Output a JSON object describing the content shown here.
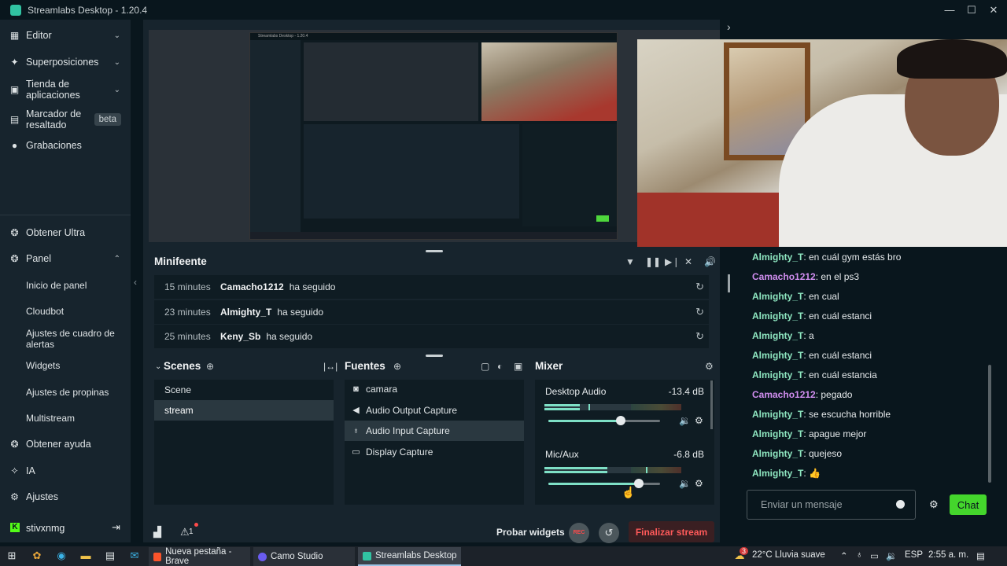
{
  "window": {
    "title": "Streamlabs Desktop - 1.20.4",
    "controls": [
      "—",
      "☐",
      "✕"
    ]
  },
  "sidebar": {
    "items": [
      {
        "label": "Editor",
        "icon": "editor-icon",
        "chevron": "⌄"
      },
      {
        "label": "Superposiciones",
        "icon": "overlays-icon",
        "chevron": "⌄"
      },
      {
        "label": "Tienda de aplicaciones",
        "icon": "store-icon",
        "chevron": "⌄"
      },
      {
        "label": "Marcador de resaltado",
        "icon": "highlighter-icon",
        "badge": "beta"
      },
      {
        "label": "Grabaciones",
        "icon": "recordings-icon"
      },
      {
        "label": "Obtener Ultra",
        "icon": "ultra-icon"
      },
      {
        "label": "Panel",
        "icon": "panel-icon",
        "chevron": "⌃"
      },
      {
        "label": "Obtener ayuda",
        "icon": "help-icon"
      },
      {
        "label": "IA",
        "icon": "ai-icon"
      },
      {
        "label": "Ajustes",
        "icon": "settings-icon"
      }
    ],
    "panel_subitems": [
      "Inicio de panel",
      "Cloudbot",
      "Ajustes de cuadro de alertas",
      "Widgets",
      "Ajustes de propinas",
      "Multistream"
    ],
    "user": {
      "name": "stivxnmg"
    }
  },
  "minifeed": {
    "title": "Minifeente",
    "rows": [
      {
        "time": "15 minutes",
        "name": "Camacho1212",
        "action": "ha seguido"
      },
      {
        "time": "23 minutes",
        "name": "Almighty_T",
        "action": "ha seguido"
      },
      {
        "time": "25 minutes",
        "name": "Keny_Sb",
        "action": "ha seguido"
      }
    ]
  },
  "scenes": {
    "title": "Scenes",
    "items": [
      "Scene",
      "stream"
    ],
    "selected": "stream"
  },
  "sources": {
    "title": "Fuentes",
    "items": [
      {
        "label": "camara",
        "icon": "camera-icon"
      },
      {
        "label": "Audio Output Capture",
        "icon": "speaker-icon"
      },
      {
        "label": "Audio Input Capture",
        "icon": "microphone-icon"
      },
      {
        "label": "Display Capture",
        "icon": "monitor-icon"
      }
    ],
    "selected": "Audio Input Capture"
  },
  "mixer": {
    "title": "Mixer",
    "channels": [
      {
        "name": "Desktop Audio",
        "db": "-13.4 dB",
        "level": 0.26,
        "volume": 0.65
      },
      {
        "name": "Mic/Aux",
        "db": "-6.8 dB",
        "level": 0.46,
        "volume": 0.81
      }
    ]
  },
  "bottom": {
    "test_widgets": "Probar widgets",
    "rec": "REC",
    "end_stream": "Finalizar stream",
    "notification_count": "1"
  },
  "chat": {
    "messages": [
      {
        "user": "Almighty_T",
        "text": ": en cuál gym estás bro",
        "color": "#8ee6c0"
      },
      {
        "user": "Camacho1212",
        "text": ": en el ps3",
        "color": "#d18ef0"
      },
      {
        "user": "Almighty_T",
        "text": ": en cual",
        "color": "#8ee6c0"
      },
      {
        "user": "Almighty_T",
        "text": ": en cuál estanci",
        "color": "#8ee6c0"
      },
      {
        "user": "Almighty_T",
        "text": ": a",
        "color": "#8ee6c0"
      },
      {
        "user": "Almighty_T",
        "text": ": en cuál estanci",
        "color": "#8ee6c0"
      },
      {
        "user": "Almighty_T",
        "text": ": en cuál estancia",
        "color": "#8ee6c0"
      },
      {
        "user": "Camacho1212",
        "text": ": pegado",
        "color": "#d18ef0"
      },
      {
        "user": "Almighty_T",
        "text": ": se escucha horrible",
        "color": "#8ee6c0"
      },
      {
        "user": "Almighty_T",
        "text": ": apague mejor",
        "color": "#8ee6c0"
      },
      {
        "user": "Almighty_T",
        "text": ": quejeso",
        "color": "#8ee6c0"
      },
      {
        "user": "Almighty_T",
        "text": ": 👍",
        "color": "#8ee6c0"
      }
    ],
    "input_placeholder": "Enviar un mensaje",
    "send_label": "Chat"
  },
  "taskbar": {
    "tasks": [
      {
        "label": "Nueva pestaña - Brave",
        "color": "#fb542b"
      },
      {
        "label": "Camo Studio",
        "color": "#6a5cf0"
      },
      {
        "label": "Streamlabs Desktop",
        "color": "#31c3a2"
      }
    ],
    "weather": "22°C  Lluvia suave",
    "weather_badge": "3",
    "language": "ESP",
    "time": "2:55 a. m."
  }
}
